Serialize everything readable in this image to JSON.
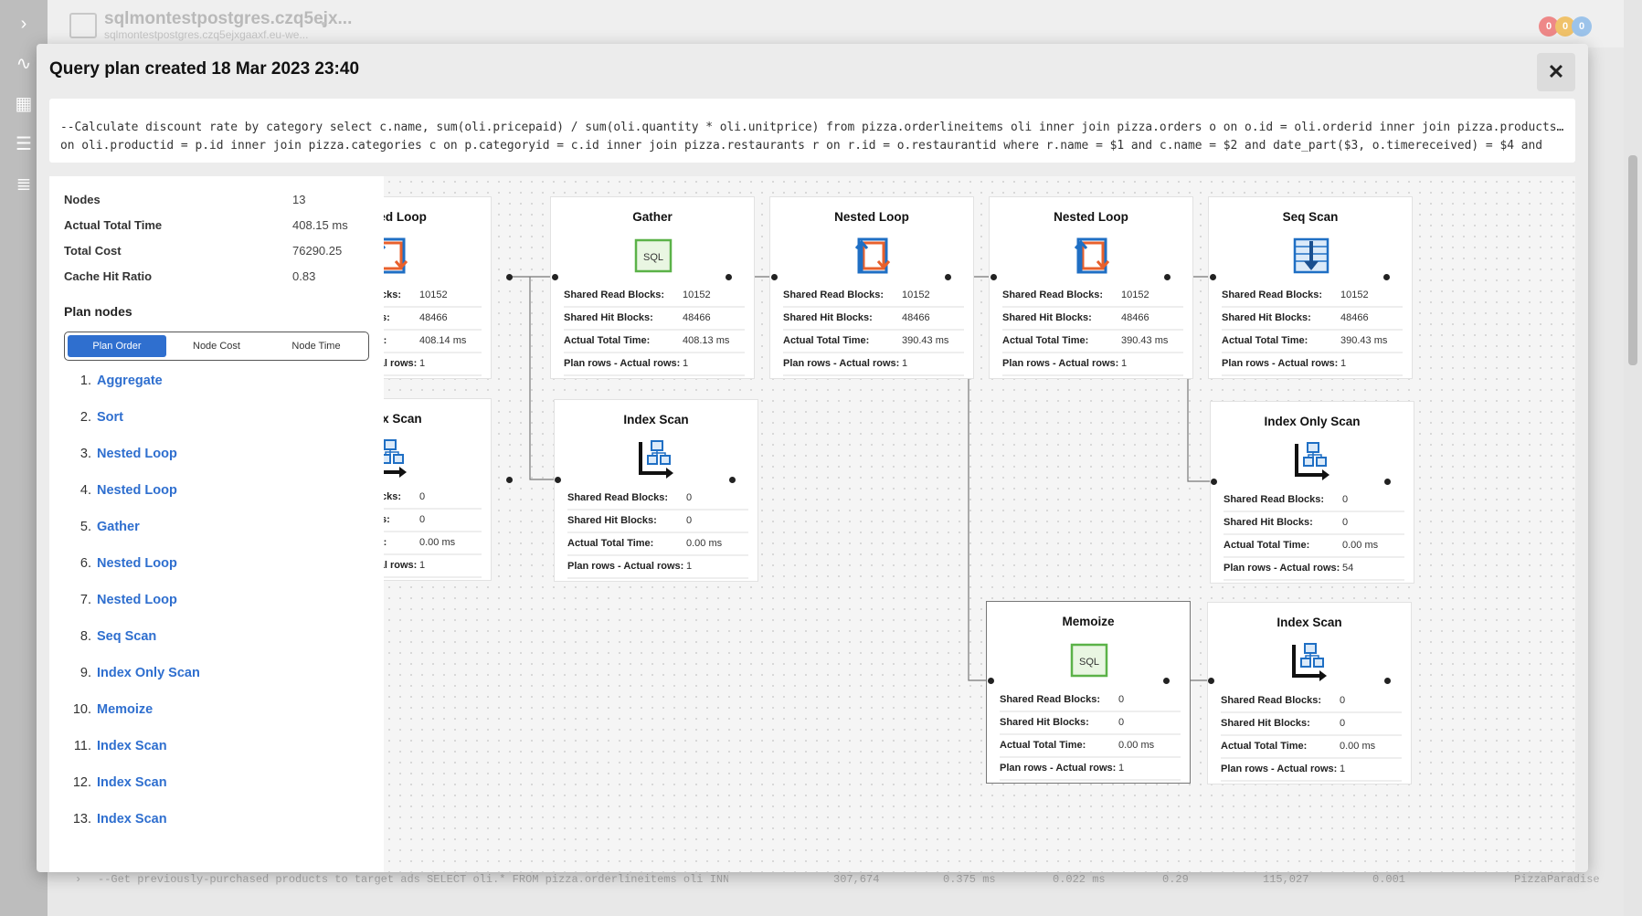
{
  "app": {
    "server_name": "sqlmontestpostgres.czq5ejx...",
    "server_host": "sqlmontestpostgres.czq5ejxgaaxf.eu-we...",
    "badges": [
      {
        "value": "0",
        "color": "#e88"
      },
      {
        "value": "0",
        "color": "#f0c26a"
      },
      {
        "value": "0",
        "color": "#9cc3ea"
      }
    ],
    "background_row": {
      "query": "--Get previously-purchased products to target ads SELECT oli.* FROM pizza.orderlineitems oli INNER JOIN pizza...",
      "executions": "307,674",
      "avg_duration": "0.375 ms",
      "avg_cpu": "0.022 ms",
      "col4": "0.29",
      "col5": "115,027",
      "col6": "0.001",
      "database": "PizzaParadise"
    }
  },
  "modal": {
    "title": "Query plan created 18 Mar 2023 23:40",
    "close_label": "✕",
    "sql_line1": "--Calculate discount rate by category select c.name, sum(oli.pricepaid) / sum(oli.quantity * oli.unitprice) from pizza.orderlineitems oli inner join pizza.orders o on o.id = oli.orderid inner join pizza.products p…",
    "sql_line2": "on oli.productid = p.id inner join pizza.categories c on p.categoryid = c.id inner join pizza.restaurants r on r.id = o.restaurantid where r.name = $1 and c.name = $2 and date_part($3, o.timereceived) = $4 and"
  },
  "summary": {
    "nodes_label": "Nodes",
    "nodes_value": "13",
    "time_label": "Actual Total Time",
    "time_value": "408.15 ms",
    "cost_label": "Total Cost",
    "cost_value": "76290.25",
    "cache_label": "Cache Hit Ratio",
    "cache_value": "0.83"
  },
  "plan_nodes": {
    "title": "Plan nodes",
    "tabs": [
      "Plan Order",
      "Node Cost",
      "Node Time"
    ],
    "active_tab": "Plan Order",
    "items": [
      {
        "num": "1.",
        "name": "Aggregate"
      },
      {
        "num": "2.",
        "name": "Sort"
      },
      {
        "num": "3.",
        "name": "Nested Loop"
      },
      {
        "num": "4.",
        "name": "Nested Loop"
      },
      {
        "num": "5.",
        "name": "Gather"
      },
      {
        "num": "6.",
        "name": "Nested Loop"
      },
      {
        "num": "7.",
        "name": "Nested Loop"
      },
      {
        "num": "8.",
        "name": "Seq Scan"
      },
      {
        "num": "9.",
        "name": "Index Only Scan"
      },
      {
        "num": "10.",
        "name": "Memoize"
      },
      {
        "num": "11.",
        "name": "Index Scan"
      },
      {
        "num": "12.",
        "name": "Index Scan"
      },
      {
        "num": "13.",
        "name": "Index Scan"
      }
    ]
  },
  "labels": {
    "read": "Shared Read Blocks:",
    "hit": "Shared Hit Blocks:",
    "time": "Actual Total Time:",
    "rows": "Plan rows - Actual rows:"
  },
  "graph_nodes": [
    {
      "id": "n1",
      "title": "Nested Loop",
      "icon": "nested-loop",
      "read": "10152",
      "hit": "48466",
      "time": "408.14 ms",
      "rows": "1",
      "partial": true
    },
    {
      "id": "n2",
      "title": "Gather",
      "icon": "sql",
      "read": "10152",
      "hit": "48466",
      "time": "408.13 ms",
      "rows": "1"
    },
    {
      "id": "n3",
      "title": "Nested Loop",
      "icon": "nested-loop",
      "read": "10152",
      "hit": "48466",
      "time": "390.43 ms",
      "rows": "1"
    },
    {
      "id": "n4",
      "title": "Nested Loop",
      "icon": "nested-loop",
      "read": "10152",
      "hit": "48466",
      "time": "390.43 ms",
      "rows": "1"
    },
    {
      "id": "n5",
      "title": "Seq Scan",
      "icon": "seq-scan",
      "read": "10152",
      "hit": "48466",
      "time": "390.43 ms",
      "rows": "1"
    },
    {
      "id": "n6",
      "title": "Index Scan",
      "icon": "index-scan",
      "read": "0",
      "hit": "0",
      "time": "0.00 ms",
      "rows": "1",
      "partial": true
    },
    {
      "id": "n7",
      "title": "Index Scan",
      "icon": "index-scan",
      "read": "0",
      "hit": "0",
      "time": "0.00 ms",
      "rows": "1"
    },
    {
      "id": "n8",
      "title": "Index Only Scan",
      "icon": "index-scan",
      "read": "0",
      "hit": "0",
      "time": "0.00 ms",
      "rows": "54"
    },
    {
      "id": "n9",
      "title": "Memoize",
      "icon": "sql",
      "read": "0",
      "hit": "0",
      "time": "0.00 ms",
      "rows": "1",
      "selected": true
    },
    {
      "id": "n10",
      "title": "Index Scan",
      "icon": "index-scan",
      "read": "0",
      "hit": "0",
      "time": "0.00 ms",
      "rows": "1"
    }
  ]
}
